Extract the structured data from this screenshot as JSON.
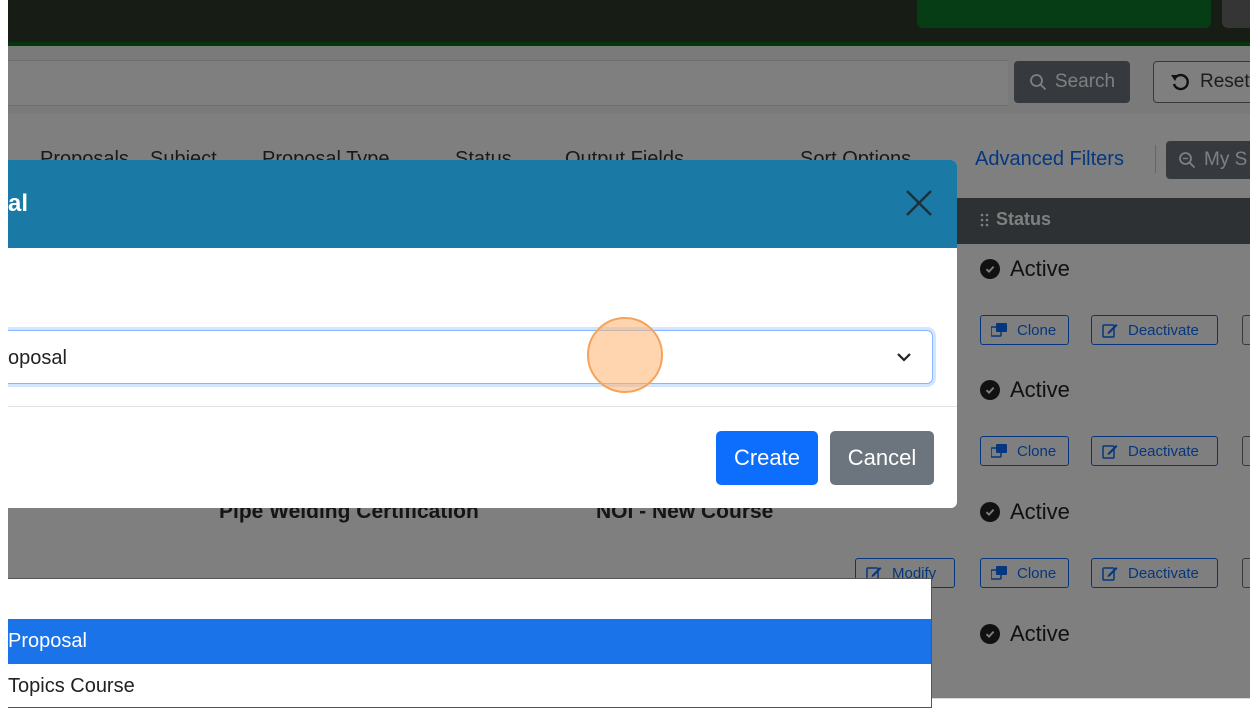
{
  "search_bar": {
    "search_label": "Search",
    "reset_label": "Reset"
  },
  "filters": {
    "tabs": [
      "Proposals",
      "Subject",
      "Proposal Type",
      "Status",
      "Output Fields",
      "Sort Options"
    ],
    "advanced_filters_label": "Advanced Filters",
    "my_search_label": "My S"
  },
  "table": {
    "status_header": "Status",
    "rows": [
      {
        "status": "Active",
        "clone_label": "Clone",
        "deactivate_label": "Deactivate"
      },
      {
        "status": "Active",
        "clone_label": "Clone",
        "deactivate_label": "Deactivate"
      },
      {
        "title": "Pipe Welding Certification",
        "proposal_type": "NOI - New Course",
        "status": "Active",
        "modify_label": "Modify",
        "clone_label": "Clone",
        "deactivate_label": "Deactivate"
      },
      {
        "status": "Active"
      }
    ]
  },
  "modal": {
    "title": "al",
    "select_value": "oposal",
    "create_label": "Create",
    "cancel_label": "Cancel"
  },
  "dropdown": {
    "options": [
      {
        "label": "",
        "selected": false
      },
      {
        "label": "Proposal",
        "selected": true
      },
      {
        "label": "Topics Course",
        "selected": false
      }
    ]
  },
  "colors": {
    "modal_header": "#1b79a5",
    "primary": "#0d6efd",
    "secondary": "#6c757d",
    "dropdown_highlight": "#1a73e8",
    "click_indicator": "#f5a25a"
  },
  "icons": [
    "search-icon",
    "reset-icon",
    "close-icon",
    "chevron-down-icon",
    "check-circle-icon",
    "clone-icon",
    "edit-icon",
    "drag-handle-icon"
  ]
}
